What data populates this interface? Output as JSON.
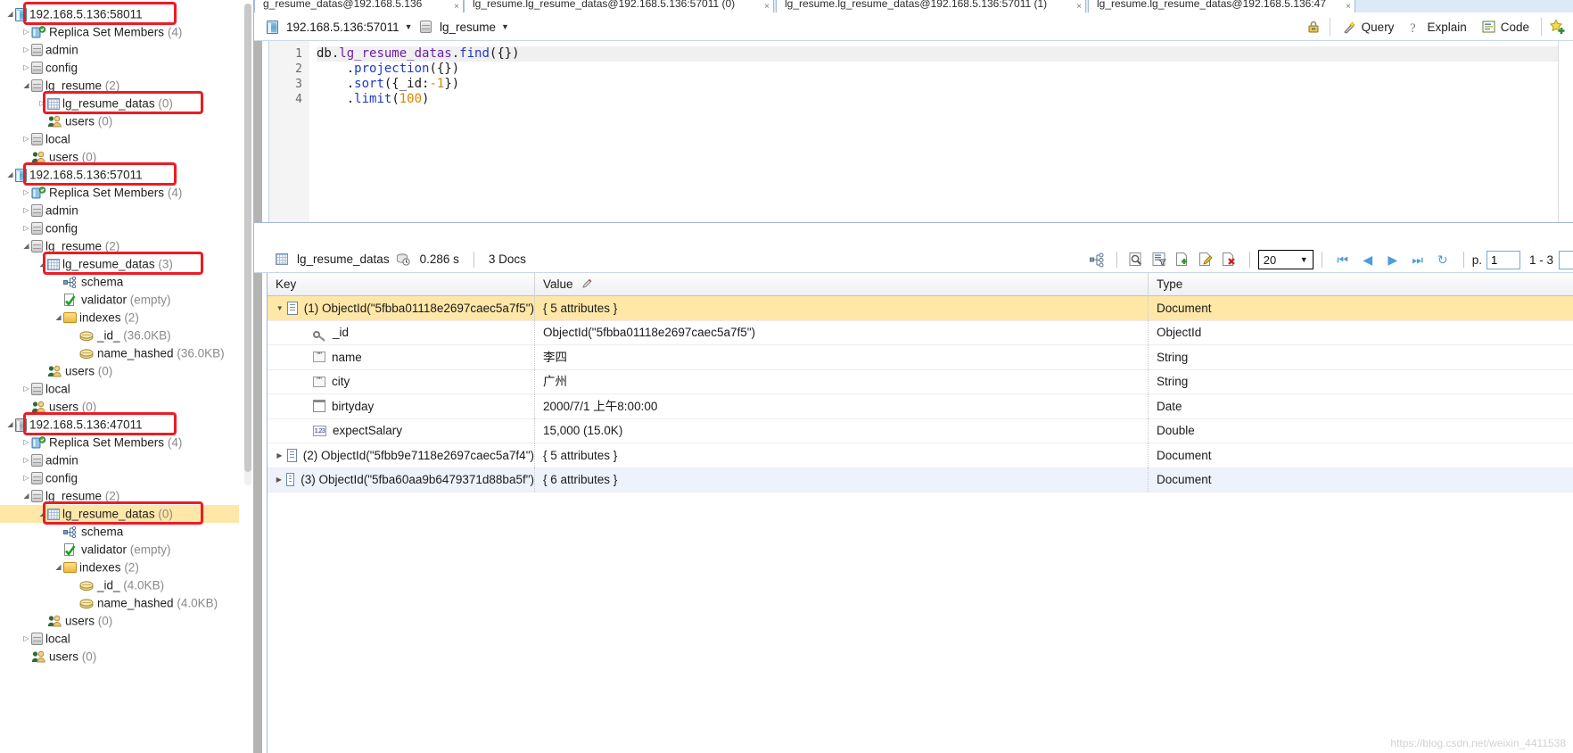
{
  "tabs": [
    {
      "label": "g_resume_datas@192.168.5.136",
      "active": false
    },
    {
      "label": "lg_resume.lg_resume_datas@192.168.5.136:57011 (0)",
      "active": false
    },
    {
      "label": "lg_resume.lg_resume_datas@192.168.5.136:57011 (1)",
      "active": false
    },
    {
      "label": "lg_resume.lg_resume_datas@192.168.5.136:47",
      "active": true
    }
  ],
  "toolbar": {
    "connection": "192.168.5.136:57011",
    "database": "lg_resume",
    "caret": "▼",
    "buttons": [
      {
        "name": "lock-icon",
        "label": ""
      },
      {
        "name": "query-button",
        "label": "Query"
      },
      {
        "name": "explain-button",
        "label": "Explain"
      },
      {
        "name": "code-button",
        "label": "Code"
      },
      {
        "name": "add-favorite-icon",
        "label": ""
      }
    ]
  },
  "editor": {
    "line_numbers": [
      "1",
      "2",
      "3",
      "4"
    ],
    "lines": [
      "db.lg_resume_datas.find({})",
      "    .projection({})",
      "    .sort({_id:-1})",
      "    .limit(100)"
    ],
    "collection": "lg_resume_datas",
    "projection_arg": "{}",
    "sort_arg": "{_id:-1}",
    "limit_arg": "100"
  },
  "results": {
    "collection": "lg_resume_datas",
    "time": "0.286 s",
    "docs": "3 Docs",
    "page_size": "20",
    "page_label": "p.",
    "page_number": "1",
    "range": "1 - 3",
    "columns": [
      "Key",
      "Value",
      "Type"
    ],
    "rows": [
      {
        "indent": 0,
        "twisty": "▼",
        "icon": "document-icon",
        "key": "(1) ObjectId(\"5fbba01118e2697caec5a7f5\")",
        "value": "{ 5 attributes }",
        "type": "Document",
        "highlight": "selected"
      },
      {
        "indent": 1,
        "twisty": "",
        "icon": "key-icon",
        "key": "_id",
        "value": "ObjectId(\"5fbba01118e2697caec5a7f5\")",
        "type": "ObjectId",
        "highlight": "none"
      },
      {
        "indent": 1,
        "twisty": "",
        "icon": "string-icon",
        "key": "name",
        "value": "李四",
        "type": "String",
        "highlight": "none"
      },
      {
        "indent": 1,
        "twisty": "",
        "icon": "string-icon",
        "key": "city",
        "value": "广州",
        "type": "String",
        "highlight": "none"
      },
      {
        "indent": 1,
        "twisty": "",
        "icon": "date-icon",
        "key": "birtyday",
        "value": "2000/7/1 上午8:00:00",
        "type": "Date",
        "highlight": "none"
      },
      {
        "indent": 1,
        "twisty": "",
        "icon": "number-icon",
        "key": "expectSalary",
        "value": "15,000 (15.0K)",
        "type": "Double",
        "highlight": "none"
      },
      {
        "indent": 0,
        "twisty": "▶",
        "icon": "document-icon",
        "key": "(2) ObjectId(\"5fbb9e7118e2697caec5a7f4\")",
        "value": "{ 5 attributes }",
        "type": "Document",
        "highlight": "none"
      },
      {
        "indent": 0,
        "twisty": "▶",
        "icon": "document-icon",
        "key": "(3) ObjectId(\"5fba60aa9b6479371d88ba5f\")",
        "value": "{ 6 attributes }",
        "type": "Document",
        "highlight": "alt"
      }
    ]
  },
  "sidebar": {
    "nodes": [
      {
        "depth": 0,
        "twisty": "◢",
        "icon": "server-icon",
        "label": "192.168.5.136:58011",
        "count": "",
        "highlight": false,
        "boxed": true
      },
      {
        "depth": 1,
        "twisty": "▷",
        "icon": "replica-icon",
        "label": "Replica Set Members",
        "count": "(4)",
        "highlight": false,
        "boxed": false
      },
      {
        "depth": 1,
        "twisty": "▷",
        "icon": "db-icon",
        "label": "admin",
        "count": "",
        "highlight": false,
        "boxed": false
      },
      {
        "depth": 1,
        "twisty": "▷",
        "icon": "db-icon",
        "label": "config",
        "count": "",
        "highlight": false,
        "boxed": false
      },
      {
        "depth": 1,
        "twisty": "◢",
        "icon": "db-icon",
        "label": "lg_resume",
        "count": "(2)",
        "highlight": false,
        "boxed": false
      },
      {
        "depth": 2,
        "twisty": "▷",
        "icon": "collection-icon",
        "label": "lg_resume_datas",
        "count": "(0)",
        "highlight": false,
        "boxed": true
      },
      {
        "depth": 2,
        "twisty": "",
        "icon": "users-icon",
        "label": "users",
        "count": "(0)",
        "highlight": false,
        "boxed": false
      },
      {
        "depth": 1,
        "twisty": "▷",
        "icon": "db-icon",
        "label": "local",
        "count": "",
        "highlight": false,
        "boxed": false
      },
      {
        "depth": 1,
        "twisty": "",
        "icon": "users-icon",
        "label": "users",
        "count": "(0)",
        "highlight": false,
        "boxed": false
      },
      {
        "depth": 0,
        "twisty": "◢",
        "icon": "server-icon",
        "label": "192.168.5.136:57011",
        "count": "",
        "highlight": false,
        "boxed": true
      },
      {
        "depth": 1,
        "twisty": "▷",
        "icon": "replica-icon",
        "label": "Replica Set Members",
        "count": "(4)",
        "highlight": false,
        "boxed": false
      },
      {
        "depth": 1,
        "twisty": "▷",
        "icon": "db-icon",
        "label": "admin",
        "count": "",
        "highlight": false,
        "boxed": false
      },
      {
        "depth": 1,
        "twisty": "▷",
        "icon": "db-icon",
        "label": "config",
        "count": "",
        "highlight": false,
        "boxed": false
      },
      {
        "depth": 1,
        "twisty": "◢",
        "icon": "db-icon",
        "label": "lg_resume",
        "count": "(2)",
        "highlight": false,
        "boxed": false
      },
      {
        "depth": 2,
        "twisty": "◢",
        "icon": "collection-icon",
        "label": "lg_resume_datas",
        "count": "(3)",
        "highlight": false,
        "boxed": true
      },
      {
        "depth": 3,
        "twisty": "",
        "icon": "schema-icon",
        "label": "schema",
        "count": "",
        "highlight": false,
        "boxed": false
      },
      {
        "depth": 3,
        "twisty": "",
        "icon": "validator-icon",
        "label": "validator",
        "count": "(empty)",
        "highlight": false,
        "boxed": false
      },
      {
        "depth": 3,
        "twisty": "◢",
        "icon": "folder-icon",
        "label": "indexes",
        "count": "(2)",
        "highlight": false,
        "boxed": false
      },
      {
        "depth": 4,
        "twisty": "",
        "icon": "index-icon",
        "label": "_id_",
        "count": "(36.0KB)",
        "highlight": false,
        "boxed": false
      },
      {
        "depth": 4,
        "twisty": "",
        "icon": "index-icon",
        "label": "name_hashed",
        "count": "(36.0KB)",
        "highlight": false,
        "boxed": false
      },
      {
        "depth": 2,
        "twisty": "",
        "icon": "users-icon",
        "label": "users",
        "count": "(0)",
        "highlight": false,
        "boxed": false
      },
      {
        "depth": 1,
        "twisty": "▷",
        "icon": "db-icon",
        "label": "local",
        "count": "",
        "highlight": false,
        "boxed": false
      },
      {
        "depth": 1,
        "twisty": "",
        "icon": "users-icon",
        "label": "users",
        "count": "(0)",
        "highlight": false,
        "boxed": false
      },
      {
        "depth": 0,
        "twisty": "◢",
        "icon": "server-offline-icon",
        "label": "192.168.5.136:47011",
        "count": "",
        "highlight": false,
        "boxed": true
      },
      {
        "depth": 1,
        "twisty": "▷",
        "icon": "replica-icon",
        "label": "Replica Set Members",
        "count": "(4)",
        "highlight": false,
        "boxed": false
      },
      {
        "depth": 1,
        "twisty": "▷",
        "icon": "db-icon",
        "label": "admin",
        "count": "",
        "highlight": false,
        "boxed": false
      },
      {
        "depth": 1,
        "twisty": "▷",
        "icon": "db-icon",
        "label": "config",
        "count": "",
        "highlight": false,
        "boxed": false
      },
      {
        "depth": 1,
        "twisty": "◢",
        "icon": "db-icon",
        "label": "lg_resume",
        "count": "(2)",
        "highlight": false,
        "boxed": false
      },
      {
        "depth": 2,
        "twisty": "◢",
        "icon": "collection-icon",
        "label": "lg_resume_datas",
        "count": "(0)",
        "highlight": true,
        "boxed": true
      },
      {
        "depth": 3,
        "twisty": "",
        "icon": "schema-icon",
        "label": "schema",
        "count": "",
        "highlight": false,
        "boxed": false
      },
      {
        "depth": 3,
        "twisty": "",
        "icon": "validator-icon",
        "label": "validator",
        "count": "(empty)",
        "highlight": false,
        "boxed": false
      },
      {
        "depth": 3,
        "twisty": "◢",
        "icon": "folder-icon",
        "label": "indexes",
        "count": "(2)",
        "highlight": false,
        "boxed": false
      },
      {
        "depth": 4,
        "twisty": "",
        "icon": "index-icon",
        "label": "_id_",
        "count": "(4.0KB)",
        "highlight": false,
        "boxed": false
      },
      {
        "depth": 4,
        "twisty": "",
        "icon": "index-icon",
        "label": "name_hashed",
        "count": "(4.0KB)",
        "highlight": false,
        "boxed": false
      },
      {
        "depth": 2,
        "twisty": "",
        "icon": "users-icon",
        "label": "users",
        "count": "(0)",
        "highlight": false,
        "boxed": false
      },
      {
        "depth": 1,
        "twisty": "▷",
        "icon": "db-icon",
        "label": "local",
        "count": "",
        "highlight": false,
        "boxed": false
      },
      {
        "depth": 1,
        "twisty": "",
        "icon": "users-icon",
        "label": "users",
        "count": "(0)",
        "highlight": false,
        "boxed": false
      }
    ]
  },
  "watermark": "https://blog.csdn.net/weixin_4411538",
  "colors": {
    "selection": "#ffe7a8",
    "annotation": "#ec1c24",
    "accent": "#4a9de0"
  }
}
